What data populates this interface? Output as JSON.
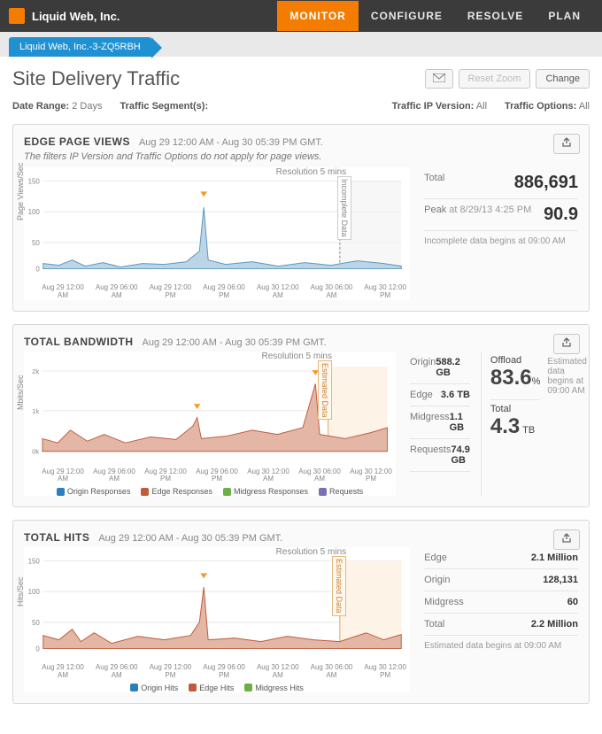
{
  "brand": "Liquid Web, Inc.",
  "nav": {
    "monitor": "MONITOR",
    "configure": "CONFIGURE",
    "resolve": "RESOLVE",
    "plan": "PLAN"
  },
  "subtab": "Liquid Web, Inc.-3-ZQ5RBH",
  "page_title": "Site Delivery Traffic",
  "buttons": {
    "reset_zoom": "Reset Zoom",
    "change": "Change"
  },
  "filters": {
    "date_range_label": "Date Range:",
    "date_range_value": "2 Days",
    "segments_label": "Traffic Segment(s):",
    "ip_label": "Traffic IP Version:",
    "ip_value": "All",
    "opts_label": "Traffic Options:",
    "opts_value": "All"
  },
  "xticks": [
    "Aug 29 12:00 AM",
    "Aug 29 06:00 AM",
    "Aug 29 12:00 PM",
    "Aug 29 06:00 PM",
    "Aug 30 12:00 AM",
    "Aug 30 06:00 AM",
    "Aug 30 12:00 PM"
  ],
  "resolution": "Resolution 5 mins",
  "inc_text": "Incomplete Data",
  "est_text": "Estimated Data",
  "panel1": {
    "title": "EDGE PAGE VIEWS",
    "subtitle": "Aug 29 12:00 AM - Aug 30 05:39 PM GMT.",
    "note": "The filters IP Version and Traffic Options do not apply for page views.",
    "ylabel": "Page Views/Sec",
    "yticks": {
      "a": "150",
      "b": "100",
      "c": "50",
      "d": "0"
    },
    "stats": {
      "total_label": "Total",
      "total_value": "886,691",
      "peak_label": "Peak",
      "peak_at_label": "at",
      "peak_time": "8/29/13 4:25 PM",
      "peak_value": "90.9",
      "footnote": "Incomplete data begins at 09:00 AM"
    }
  },
  "panel2": {
    "title": "TOTAL BANDWIDTH",
    "subtitle": "Aug 29 12:00 AM - Aug 30 05:39 PM GMT.",
    "ylabel": "Mbits/Sec",
    "yticks": {
      "a": "2k",
      "b": "1k",
      "c": "0k"
    },
    "legend": {
      "a": "Origin Responses",
      "b": "Edge Responses",
      "c": "Midgress Responses",
      "d": "Requests"
    },
    "colors": {
      "a": "#2b7fbf",
      "b": "#c05c3c",
      "c": "#6fae46",
      "d": "#7a6fb0"
    },
    "stats": {
      "origin_label": "Origin",
      "origin_value": "588.2 GB",
      "edge_label": "Edge",
      "edge_value": "3.6 TB",
      "midgress_label": "Midgress",
      "midgress_value": "1.1 GB",
      "requests_label": "Requests",
      "requests_value": "74.9 GB",
      "offload_label": "Offload",
      "offload_value": "83.6",
      "offload_unit": "%",
      "total_label": "Total",
      "total_value": "4.3",
      "total_unit": "TB",
      "footnote": "Estimated data begins at 09:00 AM"
    }
  },
  "panel3": {
    "title": "TOTAL HITS",
    "subtitle": "Aug 29 12:00 AM - Aug 30 05:39 PM GMT.",
    "ylabel": "Hits/Sec",
    "yticks": {
      "a": "150",
      "b": "100",
      "c": "50",
      "d": "0"
    },
    "legend": {
      "a": "Origin Hits",
      "b": "Edge Hits",
      "c": "Midgress Hits"
    },
    "colors": {
      "a": "#2b7fbf",
      "b": "#c05c3c",
      "c": "#6fae46"
    },
    "stats": {
      "edge_label": "Edge",
      "edge_value": "2.1 Million",
      "origin_label": "Origin",
      "origin_value": "128,131",
      "midgress_label": "Midgress",
      "midgress_value": "60",
      "total_label": "Total",
      "total_value": "2.2 Million",
      "footnote": "Estimated data begins at 09:00 AM"
    }
  },
  "chart_data": [
    {
      "id": "edge_page_views",
      "type": "area",
      "ylim": [
        0,
        150
      ],
      "ylabel": "Page Views/Sec",
      "x_range": [
        "Aug 29 12:00 AM",
        "Aug 30 05:39 PM"
      ],
      "series": [
        {
          "name": "Page Views",
          "color": "#6ea6c9",
          "baseline": 8,
          "peaks": [
            {
              "t": "Aug 29 16:25",
              "v": 90.9
            }
          ]
        }
      ],
      "incomplete_from": "Aug 30 09:00 AM"
    },
    {
      "id": "total_bandwidth",
      "type": "area",
      "ylim": [
        0,
        2000
      ],
      "ylabel": "Mbits/Sec",
      "x_range": [
        "Aug 29 12:00 AM",
        "Aug 30 05:39 PM"
      ],
      "series": [
        {
          "name": "Edge Responses",
          "color": "#c05c3c",
          "baseline": 250,
          "peaks": [
            {
              "t": "Aug 29 16:25",
              "v": 800
            },
            {
              "t": "Aug 30 07:30",
              "v": 1800
            }
          ]
        },
        {
          "name": "Origin Responses",
          "color": "#2b7fbf",
          "baseline": 40
        },
        {
          "name": "Midgress Responses",
          "color": "#6fae46",
          "baseline": 2
        },
        {
          "name": "Requests",
          "color": "#7a6fb0",
          "baseline": 25
        }
      ],
      "estimated_from": "Aug 30 09:00 AM"
    },
    {
      "id": "total_hits",
      "type": "area",
      "ylim": [
        0,
        150
      ],
      "ylabel": "Hits/Sec",
      "x_range": [
        "Aug 29 12:00 AM",
        "Aug 30 05:39 PM"
      ],
      "series": [
        {
          "name": "Edge Hits",
          "color": "#c05c3c",
          "baseline": 18,
          "peaks": [
            {
              "t": "Aug 29 16:25",
              "v": 100
            }
          ]
        },
        {
          "name": "Origin Hits",
          "color": "#2b7fbf",
          "baseline": 3
        },
        {
          "name": "Midgress Hits",
          "color": "#6fae46",
          "baseline": 0
        }
      ],
      "estimated_from": "Aug 30 09:00 AM"
    }
  ]
}
